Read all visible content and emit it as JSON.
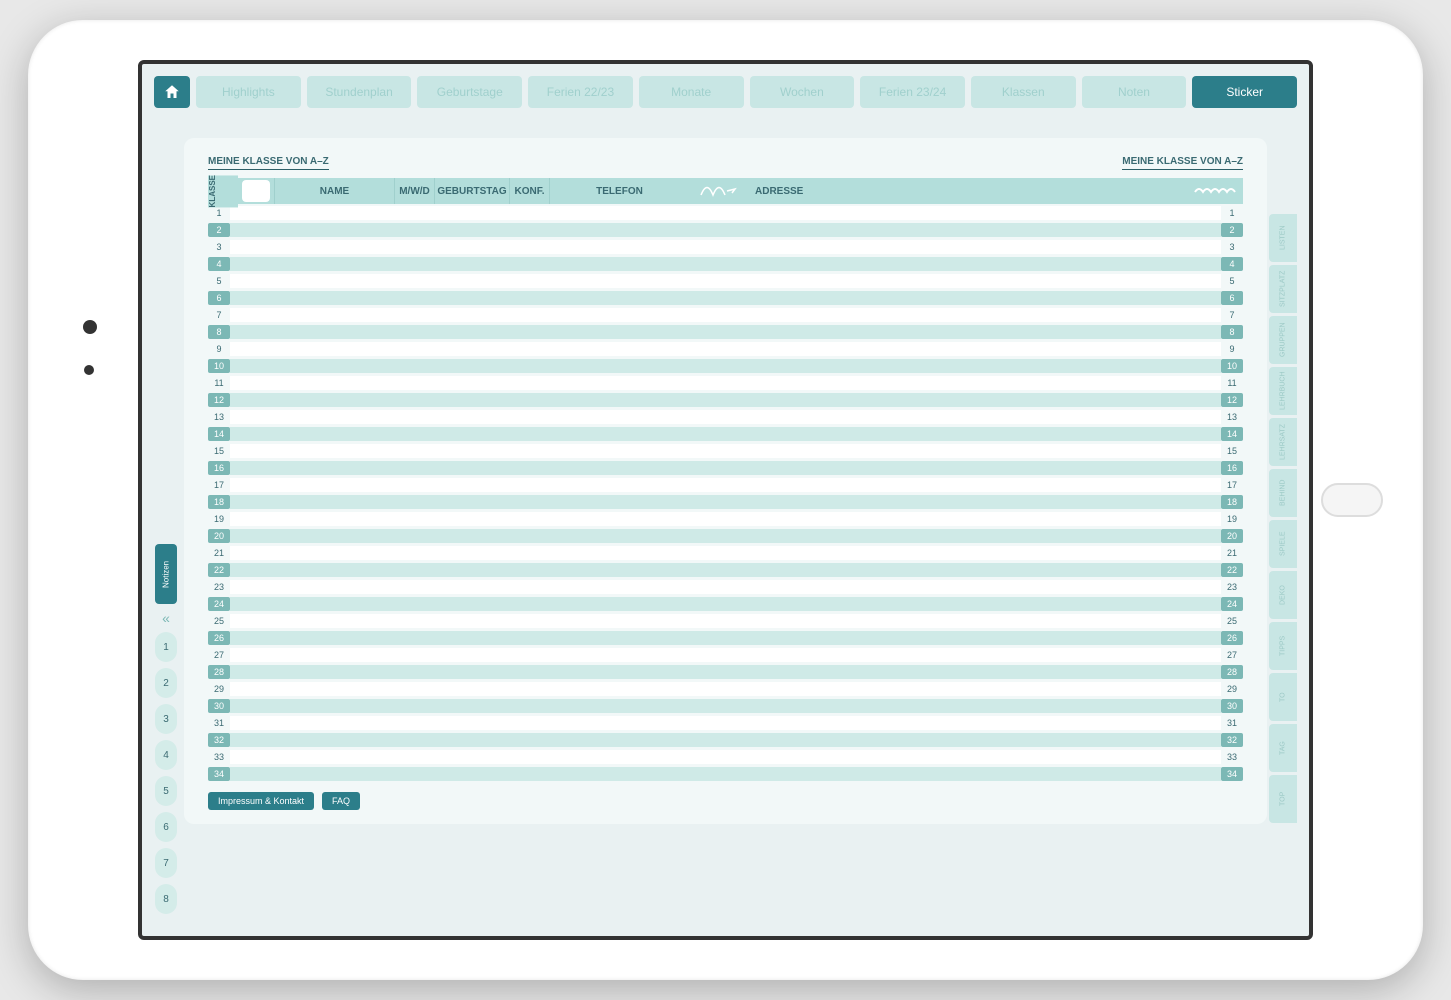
{
  "nav": {
    "items": [
      {
        "label": "Highlights"
      },
      {
        "label": "Stundenplan"
      },
      {
        "label": "Geburtstage"
      },
      {
        "label": "Ferien 22/23"
      },
      {
        "label": "Monate"
      },
      {
        "label": "Wochen"
      },
      {
        "label": "Ferien 23/24"
      },
      {
        "label": "Klassen"
      },
      {
        "label": "Noten"
      },
      {
        "label": "Sticker"
      }
    ],
    "active_index": 9
  },
  "section": {
    "title_left": "MEINE KLASSE VON A–Z",
    "title_right": "MEINE KLASSE VON A–Z"
  },
  "columns": {
    "klasse": "KLASSE",
    "name": "NAME",
    "mwd": "M/W/D",
    "geburtstag": "GEBURTSTAG",
    "konf": "KONF.",
    "telefon": "TELEFON",
    "adresse": "ADRESSE"
  },
  "row_count": 34,
  "rows": [
    1,
    2,
    3,
    4,
    5,
    6,
    7,
    8,
    9,
    10,
    11,
    12,
    13,
    14,
    15,
    16,
    17,
    18,
    19,
    20,
    21,
    22,
    23,
    24,
    25,
    26,
    27,
    28,
    29,
    30,
    31,
    32,
    33,
    34
  ],
  "footer": {
    "impressum": "Impressum & Kontakt",
    "faq": "FAQ"
  },
  "left_tabs": {
    "notizen": "Notizen",
    "chevron": "«",
    "numbers": [
      "1",
      "2",
      "3",
      "4",
      "5",
      "6",
      "7",
      "8"
    ]
  },
  "right_tabs": [
    "LISTEN",
    "SITZPLATZ",
    "GRUPPEN",
    "LEHRBUCH",
    "LEHRSATZ",
    "BEHIND",
    "SPIELE",
    "DEKO",
    "TIPPS",
    "TO",
    "TAG",
    "TOP"
  ]
}
